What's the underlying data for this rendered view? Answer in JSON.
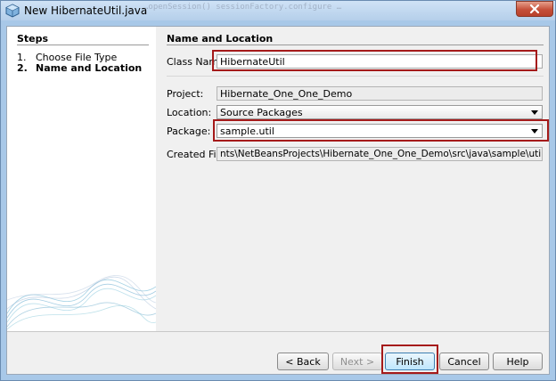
{
  "window": {
    "title": "New HibernateUtil.java",
    "ghost_text": "…openSession() sessionFactory.configure …"
  },
  "steps": {
    "title": "Steps",
    "items": [
      {
        "num": "1.",
        "label": "Choose File Type"
      },
      {
        "num": "2.",
        "label": "Name and Location"
      }
    ]
  },
  "main": {
    "title": "Name and Location",
    "class_name": {
      "label": "Class Name:",
      "value": "HibernateUtil"
    },
    "project": {
      "label": "Project:",
      "value": "Hibernate_One_One_Demo"
    },
    "location": {
      "label": "Location:",
      "value": "Source Packages"
    },
    "package": {
      "label": "Package:",
      "value": "sample.util"
    },
    "created_file": {
      "label": "Created File:",
      "value": "nts\\NetBeansProjects\\Hibernate_One_One_Demo\\src\\java\\sample\\util\\HibernateUtil.java"
    }
  },
  "buttons": {
    "back": "< Back",
    "next": "Next >",
    "finish": "Finish",
    "cancel": "Cancel",
    "help": "Help"
  },
  "colors": {
    "highlight": "#a51a1a",
    "titlebar": "#b5cfea",
    "close": "#c5503a"
  }
}
